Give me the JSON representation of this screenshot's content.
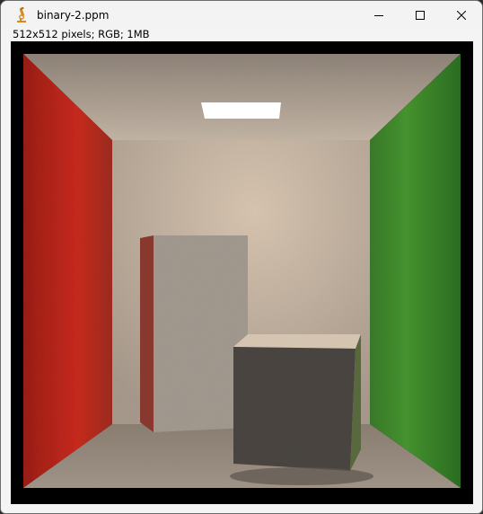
{
  "window": {
    "title": "binary-2.ppm",
    "icon": "microscope-icon"
  },
  "controls": {
    "minimize": "minimize-icon",
    "maximize": "maximize-icon",
    "close": "close-icon"
  },
  "image_info": "512x512 pixels; RGB; 1MB",
  "scene": {
    "left_wall_color": "#c0281c",
    "right_wall_color": "#3e8f2c",
    "back_wall_color": "#c9b8a6",
    "ceiling_color": "#b9aa98",
    "floor_color": "#a8998a",
    "light_color": "#ffffff"
  }
}
